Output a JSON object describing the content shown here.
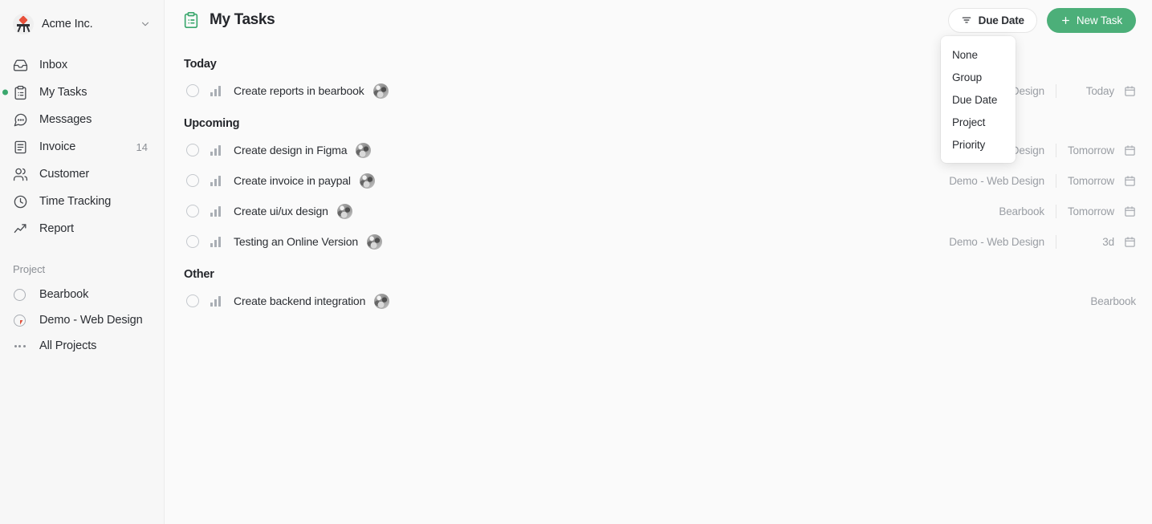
{
  "sidebar": {
    "org": {
      "name": "Acme Inc.",
      "logo_icon": "acme-logo-icon",
      "chevron_icon": "chevron-down-icon"
    },
    "items": [
      {
        "label": "Inbox",
        "icon": "inbox-icon",
        "count": "",
        "active": false
      },
      {
        "label": "My Tasks",
        "icon": "clipboard-icon",
        "count": "",
        "active": true
      },
      {
        "label": "Messages",
        "icon": "message-icon",
        "count": "",
        "active": false
      },
      {
        "label": "Invoice",
        "icon": "invoice-icon",
        "count": "14",
        "active": false
      },
      {
        "label": "Customer",
        "icon": "users-icon",
        "count": "",
        "active": false
      },
      {
        "label": "Time Tracking",
        "icon": "clock-icon",
        "count": "",
        "active": false
      },
      {
        "label": "Report",
        "icon": "chart-line-icon",
        "count": "",
        "active": false
      }
    ],
    "project_section_title": "Project",
    "projects": [
      {
        "label": "Bearbook",
        "icon": "circle-empty-icon"
      },
      {
        "label": "Demo - Web Design",
        "icon": "circle-progress-icon"
      },
      {
        "label": "All Projects",
        "icon": "ellipsis-icon"
      }
    ]
  },
  "header": {
    "title": "My Tasks",
    "title_icon": "clipboard-icon",
    "due_date_button": {
      "label": "Due Date",
      "icon": "filter-sort-icon"
    },
    "new_task_button": {
      "label": "New Task",
      "icon": "plus-icon"
    },
    "accent_green": "#4caf79"
  },
  "dropdown": {
    "open": true,
    "items": [
      {
        "label": "None"
      },
      {
        "label": "Group"
      },
      {
        "label": "Due Date"
      },
      {
        "label": "Project"
      },
      {
        "label": "Priority"
      }
    ]
  },
  "groups": [
    {
      "title": "Today",
      "tasks": [
        {
          "name": "Create reports in bearbook",
          "project": "Demo - Web Design",
          "due": "Today",
          "has_due": true,
          "avatar": "user-avatar",
          "priority_icon": "priority-bars-icon",
          "checkbox_icon": "checkbox-circle-icon",
          "calendar_icon": "calendar-icon"
        }
      ]
    },
    {
      "title": "Upcoming",
      "tasks": [
        {
          "name": "Create design in Figma",
          "project": "Demo - Web Design",
          "due": "Tomorrow",
          "has_due": true,
          "avatar": "user-avatar",
          "priority_icon": "priority-bars-icon",
          "checkbox_icon": "checkbox-circle-icon",
          "calendar_icon": "calendar-icon"
        },
        {
          "name": "Create invoice in paypal",
          "project": "Demo - Web Design",
          "due": "Tomorrow",
          "has_due": true,
          "avatar": "user-avatar",
          "priority_icon": "priority-bars-icon",
          "checkbox_icon": "checkbox-circle-icon",
          "calendar_icon": "calendar-icon"
        },
        {
          "name": "Create ui/ux design",
          "project": "Bearbook",
          "due": "Tomorrow",
          "has_due": true,
          "avatar": "user-avatar",
          "priority_icon": "priority-bars-icon",
          "checkbox_icon": "checkbox-circle-icon",
          "calendar_icon": "calendar-icon"
        },
        {
          "name": "Testing an Online Version",
          "project": "Demo - Web Design",
          "due": "3d",
          "has_due": true,
          "avatar": "user-avatar",
          "priority_icon": "priority-bars-icon",
          "checkbox_icon": "checkbox-circle-icon",
          "calendar_icon": "calendar-icon"
        }
      ]
    },
    {
      "title": "Other",
      "tasks": [
        {
          "name": "Create backend integration",
          "project": "Bearbook",
          "due": "",
          "has_due": false,
          "avatar": "user-avatar",
          "priority_icon": "priority-bars-icon",
          "checkbox_icon": "checkbox-circle-icon",
          "calendar_icon": ""
        }
      ]
    }
  ]
}
